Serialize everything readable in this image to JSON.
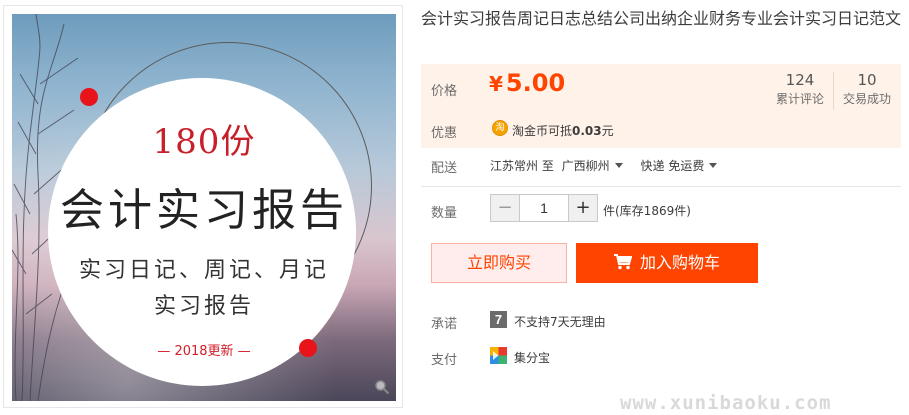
{
  "product": {
    "title": "会计实习报告周记日志总结公司出纳企业财务专业会计实习日记范文"
  },
  "image": {
    "price_text": "180份",
    "headline": "会计实习报告",
    "sub_line1": "实习日记、周记、月记",
    "sub_line2": "实习报告",
    "year_tag": "— 2018更新 —",
    "zoom_icon": "magnifier-icon"
  },
  "price": {
    "label": "价格",
    "currency": "¥",
    "value": "5.00",
    "color": "#ff4400"
  },
  "stats": {
    "reviews_count": "124",
    "reviews_label": "累计评论",
    "deals_count": "10",
    "deals_label": "交易成功"
  },
  "promo": {
    "label": "优惠",
    "icon": "taojinbi-coin-icon",
    "icon_text": "淘",
    "text_prefix": "淘金币可抵",
    "amount": "0.03",
    "suffix": "元"
  },
  "shipping": {
    "label": "配送",
    "from": "江苏常州 至",
    "to": "广西柳州",
    "method": "快递 免运费"
  },
  "quantity": {
    "label": "数量",
    "minus": "−",
    "plus": "+",
    "value": "1",
    "stock": "件(库存1869件)"
  },
  "actions": {
    "buy_now": "立即购买",
    "add_to_cart": "加入购物车",
    "cart_icon": "shopping-cart-icon"
  },
  "promise": {
    "label": "承诺",
    "icon": "no-7-day-return-icon",
    "icon_text": "7",
    "text": "不支持7天无理由"
  },
  "payment": {
    "label": "支付",
    "icon": "jifenbao-icon",
    "text": "集分宝"
  },
  "watermark": "www.xunibaoku.com"
}
